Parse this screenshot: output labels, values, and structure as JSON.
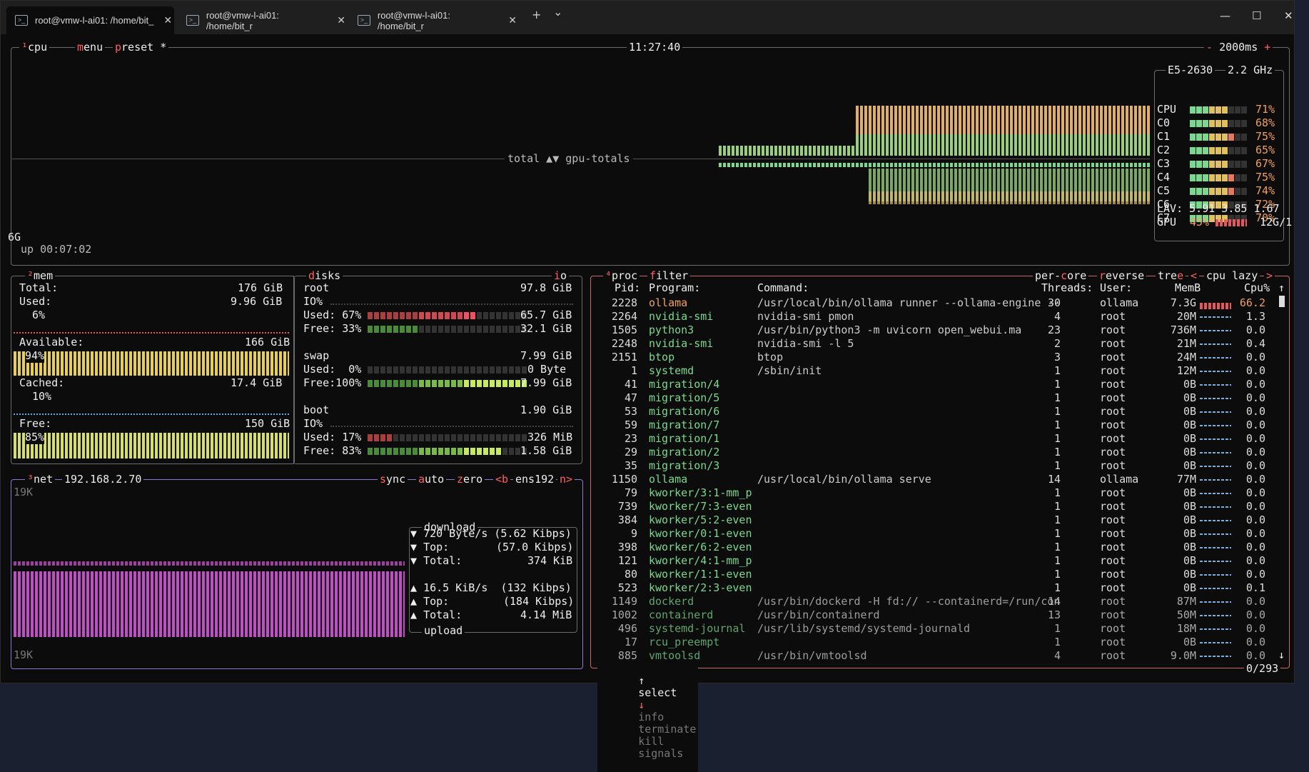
{
  "tabs": [
    {
      "title": "root@vmw-l-ai01: /home/bit_"
    },
    {
      "title": "root@vmw-l-ai01: /home/bit_r"
    },
    {
      "title": "root@vmw-l-ai01: /home/bit_r"
    }
  ],
  "toolbar": {
    "new_tab": "+",
    "dropdown": "⌄"
  },
  "window_controls": {
    "minimize": "—",
    "maximize": "☐",
    "close": "✕"
  },
  "cpu": {
    "label_num": "¹",
    "label": "cpu",
    "menu": "menu",
    "preset": "preset *",
    "clock": "11:27:40",
    "interval_minus": "-",
    "interval": "2000ms",
    "interval_plus": "+",
    "graph_label": "total ▲▼ gpu-totals",
    "scale": "6G",
    "uptime": "up 00:07:02",
    "model": "E5-2630",
    "freq": "2.2 GHz",
    "cores": [
      {
        "name": "CPU",
        "pct": "71%",
        "level": 0.71
      },
      {
        "name": "C0",
        "pct": "68%",
        "level": 0.68
      },
      {
        "name": "C1",
        "pct": "75%",
        "level": 0.75
      },
      {
        "name": "C2",
        "pct": "65%",
        "level": 0.65
      },
      {
        "name": "C3",
        "pct": "67%",
        "level": 0.67
      },
      {
        "name": "C4",
        "pct": "75%",
        "level": 0.75
      },
      {
        "name": "C5",
        "pct": "74%",
        "level": 0.74
      },
      {
        "name": "C6",
        "pct": "72%",
        "level": 0.72
      },
      {
        "name": "C7",
        "pct": "70%",
        "level": 0.7
      }
    ],
    "lav": "LAV: 5.91 3.85 1.67",
    "gpu_label": "GPU",
    "gpu_pct": "45%",
    "gpu_mem": "12G/1"
  },
  "mem": {
    "label_num": "²",
    "label": "mem",
    "total_label": "Total:",
    "total": "176 GiB",
    "used_label": "Used:",
    "used": "9.96 GiB",
    "used_pct": "6%",
    "avail_label": "Available:",
    "avail": "166 GiB",
    "avail_pct": "94%",
    "cached_label": "Cached:",
    "cached": "17.4 GiB",
    "cached_pct": "10%",
    "free_label": "Free:",
    "free": "150 GiB",
    "free_pct": "85%"
  },
  "disks": {
    "label": "disks",
    "io": "io",
    "root": {
      "name": "root",
      "size": "97.8 GiB",
      "io": "IO%",
      "used_label": "Used:",
      "used_pct": "67%",
      "used": "65.7 GiB",
      "free_label": "Free:",
      "free_pct": "33%",
      "free": "32.1 GiB"
    },
    "swap": {
      "name": "swap",
      "size": "7.99 GiB",
      "used_label": "Used:",
      "used_pct": "0%",
      "used": "0 Byte",
      "free_label": "Free:",
      "free_pct": "100%",
      "free": "7.99 GiB"
    },
    "boot": {
      "name": "boot",
      "size": "1.90 GiB",
      "io": "IO%",
      "used_label": "Used:",
      "used_pct": "17%",
      "used": "326 MiB",
      "free_label": "Free:",
      "free_pct": "83%",
      "free": "1.58 GiB"
    }
  },
  "net": {
    "label_num": "³",
    "label": "net",
    "ip": "192.168.2.70",
    "sync": "sync",
    "auto": "auto",
    "zero": "zero",
    "prev": "<b",
    "iface": "ens192",
    "next": "n>",
    "scale_top": "19K",
    "scale_bottom": "19K",
    "download_title": "download",
    "dl_rate": "720 Byte/s",
    "dl_rate_bits": "(5.62 Kibps)",
    "dl_top_label": "Top:",
    "dl_top": "(57.0 Kibps)",
    "dl_total_label": "Total:",
    "dl_total": "374 KiB",
    "ul_rate": "16.5 KiB/s",
    "ul_rate_bits": "(132 Kibps)",
    "ul_top_label": "Top:",
    "ul_top": "(184 Kibps)",
    "ul_total_label": "Total:",
    "ul_total": "4.14 MiB",
    "upload_title": "upload"
  },
  "proc": {
    "label_num": "⁴",
    "label": "proc",
    "filter": "filter",
    "per_core": "per-core",
    "reverse": "reverse",
    "tree": "tree",
    "sort_prev": "<",
    "sort": "cpu lazy",
    "sort_next": ">",
    "headers": {
      "pid": "Pid:",
      "program": "Program:",
      "command": "Command:",
      "threads": "Threads:",
      "user": "User:",
      "mem": "MemB",
      "cpu": "Cpu%"
    },
    "rows": [
      {
        "pid": "2228",
        "program": "ollama",
        "command": "/usr/local/bin/ollama runner --ollama-engine --",
        "threads": "30",
        "user": "ollama",
        "mem": "7.3G",
        "cpu": "66.2"
      },
      {
        "pid": "2264",
        "program": "nvidia-smi",
        "command": "nvidia-smi pmon",
        "threads": "4",
        "user": "root",
        "mem": "20M",
        "cpu": "1.3"
      },
      {
        "pid": "1505",
        "program": "python3",
        "command": "/usr/bin/python3 -m uvicorn open_webui.ma",
        "threads": "23",
        "user": "root",
        "mem": "736M",
        "cpu": "0.0"
      },
      {
        "pid": "2248",
        "program": "nvidia-smi",
        "command": "nvidia-smi -l 5",
        "threads": "2",
        "user": "root",
        "mem": "21M",
        "cpu": "0.4"
      },
      {
        "pid": "2151",
        "program": "btop",
        "command": "btop",
        "threads": "3",
        "user": "root",
        "mem": "24M",
        "cpu": "0.0"
      },
      {
        "pid": "1",
        "program": "systemd",
        "command": "/sbin/init",
        "threads": "1",
        "user": "root",
        "mem": "12M",
        "cpu": "0.0"
      },
      {
        "pid": "41",
        "program": "migration/4",
        "command": "",
        "threads": "1",
        "user": "root",
        "mem": "0B",
        "cpu": "0.0"
      },
      {
        "pid": "47",
        "program": "migration/5",
        "command": "",
        "threads": "1",
        "user": "root",
        "mem": "0B",
        "cpu": "0.0"
      },
      {
        "pid": "53",
        "program": "migration/6",
        "command": "",
        "threads": "1",
        "user": "root",
        "mem": "0B",
        "cpu": "0.0"
      },
      {
        "pid": "59",
        "program": "migration/7",
        "command": "",
        "threads": "1",
        "user": "root",
        "mem": "0B",
        "cpu": "0.0"
      },
      {
        "pid": "23",
        "program": "migration/1",
        "command": "",
        "threads": "1",
        "user": "root",
        "mem": "0B",
        "cpu": "0.0"
      },
      {
        "pid": "29",
        "program": "migration/2",
        "command": "",
        "threads": "1",
        "user": "root",
        "mem": "0B",
        "cpu": "0.0"
      },
      {
        "pid": "35",
        "program": "migration/3",
        "command": "",
        "threads": "1",
        "user": "root",
        "mem": "0B",
        "cpu": "0.0"
      },
      {
        "pid": "1150",
        "program": "ollama",
        "command": "/usr/local/bin/ollama serve",
        "threads": "14",
        "user": "ollama",
        "mem": "77M",
        "cpu": "0.0"
      },
      {
        "pid": "79",
        "program": "kworker/3:1-mm_p",
        "command": "",
        "threads": "1",
        "user": "root",
        "mem": "0B",
        "cpu": "0.0"
      },
      {
        "pid": "739",
        "program": "kworker/7:3-even",
        "command": "",
        "threads": "1",
        "user": "root",
        "mem": "0B",
        "cpu": "0.0"
      },
      {
        "pid": "384",
        "program": "kworker/5:2-even",
        "command": "",
        "threads": "1",
        "user": "root",
        "mem": "0B",
        "cpu": "0.0"
      },
      {
        "pid": "9",
        "program": "kworker/0:1-even",
        "command": "",
        "threads": "1",
        "user": "root",
        "mem": "0B",
        "cpu": "0.0"
      },
      {
        "pid": "398",
        "program": "kworker/6:2-even",
        "command": "",
        "threads": "1",
        "user": "root",
        "mem": "0B",
        "cpu": "0.0"
      },
      {
        "pid": "121",
        "program": "kworker/4:1-mm_p",
        "command": "",
        "threads": "1",
        "user": "root",
        "mem": "0B",
        "cpu": "0.0"
      },
      {
        "pid": "80",
        "program": "kworker/1:1-even",
        "command": "",
        "threads": "1",
        "user": "root",
        "mem": "0B",
        "cpu": "0.0"
      },
      {
        "pid": "523",
        "program": "kworker/2:3-even",
        "command": "",
        "threads": "1",
        "user": "root",
        "mem": "0B",
        "cpu": "0.1"
      },
      {
        "pid": "1149",
        "program": "dockerd",
        "command": "/usr/bin/dockerd -H fd:// --containerd=/run/con",
        "threads": "14",
        "user": "root",
        "mem": "87M",
        "cpu": "0.0"
      },
      {
        "pid": "1002",
        "program": "containerd",
        "command": "/usr/bin/containerd",
        "threads": "13",
        "user": "root",
        "mem": "50M",
        "cpu": "0.0"
      },
      {
        "pid": "496",
        "program": "systemd-journal",
        "command": "/usr/lib/systemd/systemd-journald",
        "threads": "1",
        "user": "root",
        "mem": "18M",
        "cpu": "0.0"
      },
      {
        "pid": "17",
        "program": "rcu_preempt",
        "command": "",
        "threads": "1",
        "user": "root",
        "mem": "0B",
        "cpu": "0.0"
      },
      {
        "pid": "885",
        "program": "vmtoolsd",
        "command": "/usr/bin/vmtoolsd",
        "threads": "4",
        "user": "root",
        "mem": "9.0M",
        "cpu": "0.0"
      }
    ],
    "footer_up": "↑",
    "footer_select": "select",
    "footer_down": "↓",
    "footer_info": "info",
    "footer_terminate": "terminate",
    "footer_kill": "kill",
    "footer_signals": "signals",
    "count": "0/293",
    "scroll_up": "↑",
    "scroll_down": "↓"
  },
  "colors": {
    "accent": "#e8575c",
    "border": "#6b6b6b",
    "net_graph": "#c04ec4",
    "mem_graph": "#e8d04a"
  }
}
